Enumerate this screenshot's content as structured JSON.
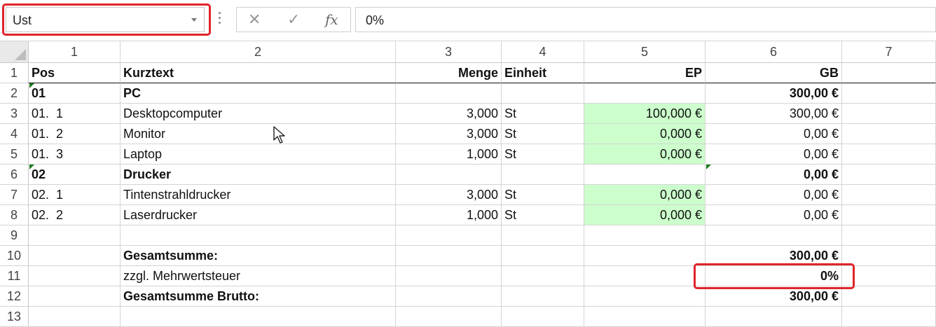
{
  "name_box": {
    "value": "Ust"
  },
  "formula_bar": {
    "cancel_icon": "✕",
    "enter_icon": "✓",
    "function_icon": "fx",
    "content": "0%"
  },
  "columns": [
    "1",
    "2",
    "3",
    "4",
    "5",
    "6",
    "7"
  ],
  "rows": [
    {
      "num": "1",
      "cells": [
        "Pos",
        "Kurztext",
        "Menge",
        "Einheit",
        "EP",
        "GB",
        ""
      ]
    },
    {
      "num": "2",
      "cells": [
        "01",
        "PC",
        "",
        "",
        "",
        "300,00 €",
        ""
      ]
    },
    {
      "num": "3",
      "cells": [
        "01.  1",
        "Desktopcomputer",
        "3,000",
        "St",
        "100,000 €",
        "300,00 €",
        ""
      ]
    },
    {
      "num": "4",
      "cells": [
        "01.  2",
        "Monitor",
        "3,000",
        "St",
        "0,000 €",
        "0,00 €",
        ""
      ]
    },
    {
      "num": "5",
      "cells": [
        "01.  3",
        "Laptop",
        "1,000",
        "St",
        "0,000 €",
        "0,00 €",
        ""
      ]
    },
    {
      "num": "6",
      "cells": [
        "02",
        "Drucker",
        "",
        "",
        "",
        "0,00 €",
        ""
      ]
    },
    {
      "num": "7",
      "cells": [
        "02.  1",
        "Tintenstrahldrucker",
        "3,000",
        "St",
        "0,000 €",
        "0,00 €",
        ""
      ]
    },
    {
      "num": "8",
      "cells": [
        "02.  2",
        "Laserdrucker",
        "1,000",
        "St",
        "0,000 €",
        "0,00 €",
        ""
      ]
    },
    {
      "num": "9",
      "cells": [
        "",
        "",
        "",
        "",
        "",
        "",
        ""
      ]
    },
    {
      "num": "10",
      "cells": [
        "",
        "Gesamtsumme:",
        "",
        "",
        "",
        "300,00 €",
        ""
      ]
    },
    {
      "num": "11",
      "cells": [
        "",
        "zzgl. Mehrwertsteuer",
        "",
        "",
        "",
        "0%",
        ""
      ]
    },
    {
      "num": "12",
      "cells": [
        "",
        "Gesamtsumme Brutto:",
        "",
        "",
        "",
        "300,00 €",
        ""
      ]
    },
    {
      "num": "13",
      "cells": [
        "",
        "",
        "",
        "",
        "",
        "",
        ""
      ]
    }
  ],
  "colors": {
    "highlight": "#e0242b",
    "input_fill": "#ccffcc",
    "comment_marker": "#1b7a1b"
  }
}
